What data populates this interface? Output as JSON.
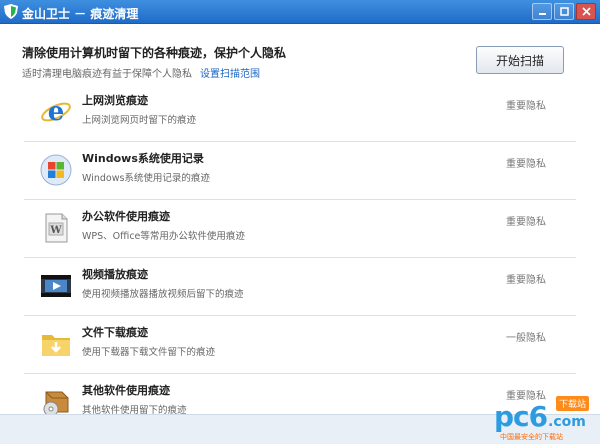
{
  "window": {
    "title": "金山卫士 － 痕迹清理"
  },
  "header": {
    "headline": "清除使用计算机时留下的各种痕迹，保护个人隐私",
    "subtext": "适时清理电脑痕迹有益于保障个人隐私",
    "settings_link": "设置扫描范围",
    "scan_button": "开始扫描"
  },
  "items": [
    {
      "title": "上网浏览痕迹",
      "desc": "上网浏览网页时留下的痕迹",
      "level": "重要隐私",
      "icon": "ie-icon"
    },
    {
      "title": "Windows系统使用记录",
      "desc": "Windows系统使用记录的痕迹",
      "level": "重要隐私",
      "icon": "windows-icon"
    },
    {
      "title": "办公软件使用痕迹",
      "desc": "WPS、Office等常用办公软件使用痕迹",
      "level": "重要隐私",
      "icon": "document-icon"
    },
    {
      "title": "视频播放痕迹",
      "desc": "使用视频播放器播放视频后留下的痕迹",
      "level": "重要隐私",
      "icon": "video-icon"
    },
    {
      "title": "文件下载痕迹",
      "desc": "使用下载器下载文件留下的痕迹",
      "level": "一般隐私",
      "icon": "download-folder-icon"
    },
    {
      "title": "其他软件使用痕迹",
      "desc": "其他软件使用留下的痕迹",
      "level": "重要隐私",
      "icon": "software-box-icon"
    }
  ],
  "watermark": {
    "logo": "pc6",
    "domain": ".com",
    "badge": "下载站",
    "tagline": "中国最安全的下载站"
  },
  "colors": {
    "titlebar": "#2a7bd6",
    "link": "#1a64c4",
    "divider": "#d7e1ee"
  }
}
